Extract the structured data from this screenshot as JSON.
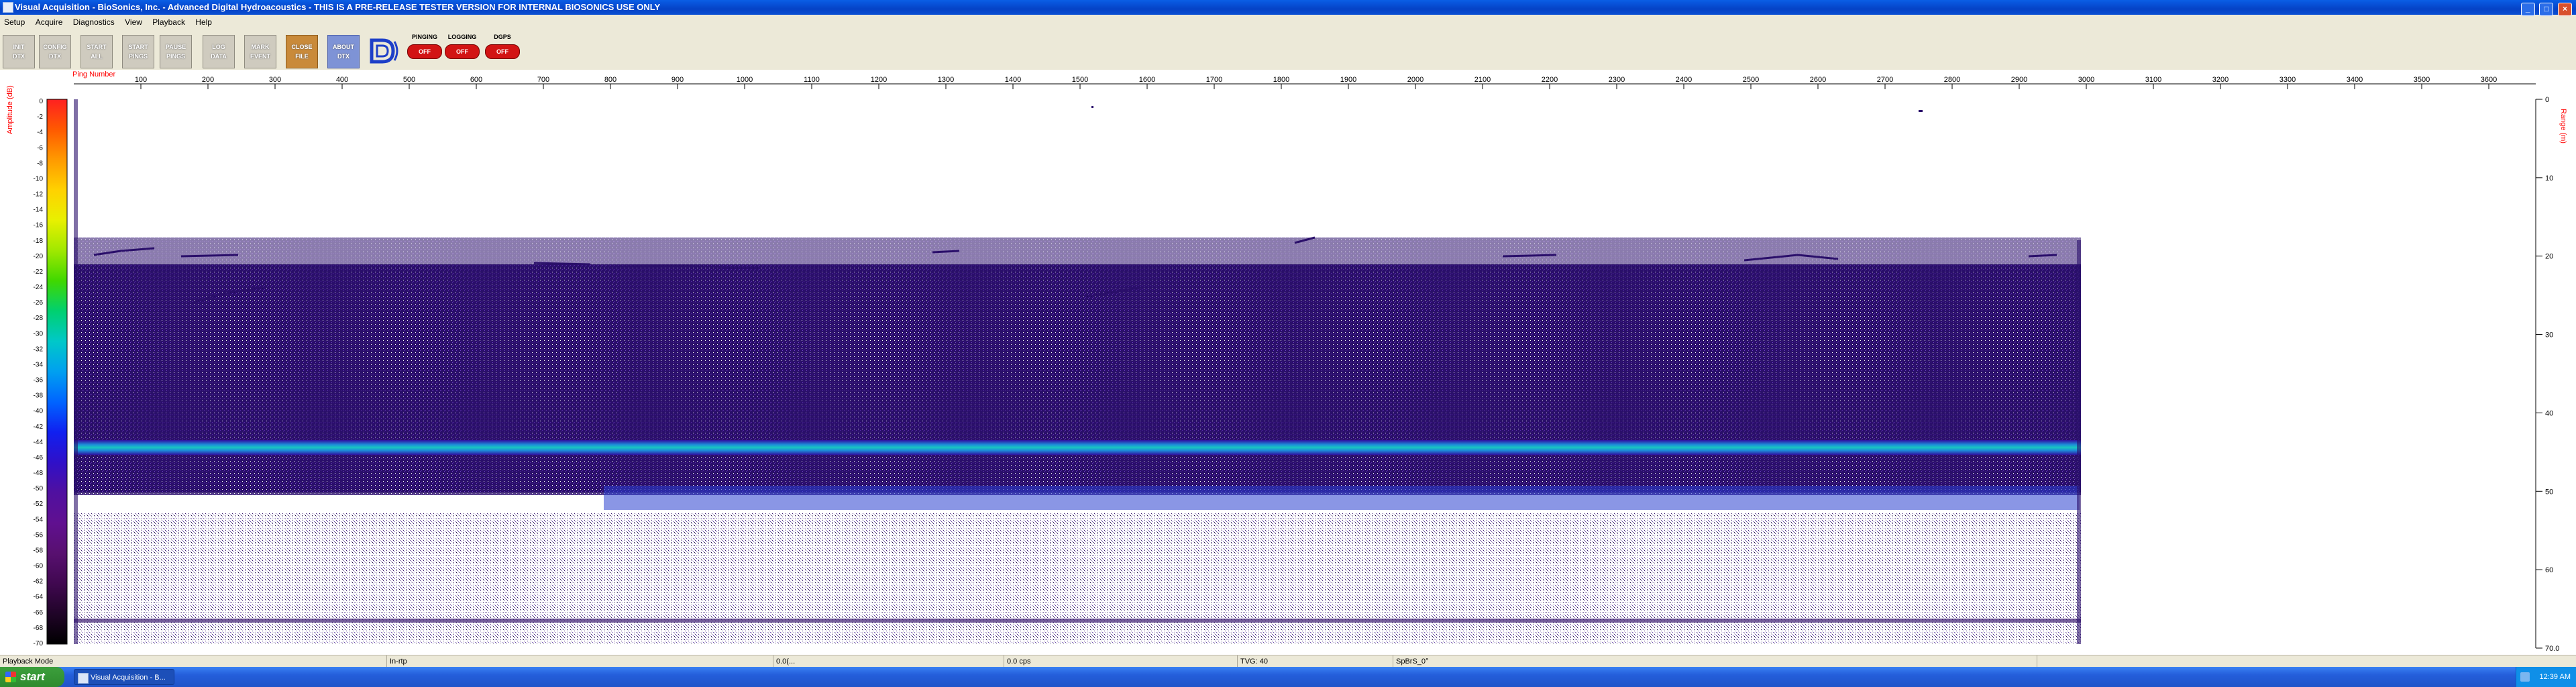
{
  "window": {
    "title": "Visual Acquisition  -  BioSonics, Inc.  -  Advanced Digital Hydroacoustics  -  THIS IS A PRE-RELEASE TESTER VERSION FOR INTERNAL BIOSONICS USE ONLY",
    "minimize": "_",
    "maximize": "□",
    "close": "×"
  },
  "menu": [
    "Setup",
    "Acquire",
    "Diagnostics",
    "View",
    "Playback",
    "Help"
  ],
  "toolbar": {
    "buttons": [
      {
        "label1": "INIT",
        "label2": "DTX",
        "style": "gray"
      },
      {
        "label1": "CONFIG",
        "label2": "DTX",
        "style": "gray"
      },
      {
        "label1": "START",
        "label2": "ALL",
        "style": "gray"
      },
      {
        "label1": "START",
        "label2": "PINGS",
        "style": "gray"
      },
      {
        "label1": "PAUSE",
        "label2": "PINGS",
        "style": "gray"
      },
      {
        "label1": "LOG",
        "label2": "DATA",
        "style": "gray"
      },
      {
        "label1": "MARK",
        "label2": "EVENT",
        "style": "gray"
      },
      {
        "label1": "CLOSE",
        "label2": "FILE",
        "style": "orange"
      },
      {
        "label1": "ABOUT",
        "label2": "DTX",
        "style": "blue"
      }
    ],
    "status_lights": [
      {
        "label": "PINGING",
        "state": "OFF"
      },
      {
        "label": "LOGGING",
        "state": "OFF"
      },
      {
        "label": "DGPS",
        "state": "OFF"
      }
    ]
  },
  "echogram": {
    "x_axis_label": "Ping Number",
    "x_ticks": [
      "100",
      "200",
      "300",
      "400",
      "500",
      "600",
      "700",
      "800",
      "900",
      "1000",
      "1100",
      "1200",
      "1300",
      "1400",
      "1500",
      "1600",
      "1700",
      "1800",
      "1900",
      "2000",
      "2100",
      "2200",
      "2300",
      "2400",
      "2500",
      "2600",
      "2700",
      "2800",
      "2900",
      "3000",
      "3100",
      "3200",
      "3300",
      "3400",
      "3500",
      "3600"
    ],
    "colorbar_label": "Amplitude (dB)",
    "colorbar_ticks": [
      "0",
      "-2",
      "-4",
      "-6",
      "-8",
      "-10",
      "-12",
      "-14",
      "-16",
      "-18",
      "-20",
      "-22",
      "-24",
      "-26",
      "-28",
      "-30",
      "-32",
      "-34",
      "-36",
      "-38",
      "-40",
      "-42",
      "-44",
      "-46",
      "-48",
      "-50",
      "-52",
      "-54",
      "-56",
      "-58",
      "-60",
      "-62",
      "-64",
      "-66",
      "-68",
      "-70"
    ],
    "colorbar_colors": [
      "#ff2020",
      "#ff5a00",
      "#ff9a00",
      "#ffd200",
      "#e8f000",
      "#a0e800",
      "#40d800",
      "#00d070",
      "#00c8c8",
      "#00a0f0",
      "#0064ff",
      "#1020f0",
      "#3010c8",
      "#5010a0",
      "#601090",
      "#581070",
      "#400850",
      "#200428",
      "#000000"
    ],
    "right_axis_label": "Range (m)",
    "depth_ticks": [
      "0",
      "10",
      "20",
      "30",
      "40",
      "50",
      "60",
      "70.0"
    ],
    "colors": {
      "bottom_echo": "#18c8c0",
      "scatter_layer": "#3a1d8c",
      "deep_band": "#2a3fd0",
      "accent_red": "#ff0000"
    }
  },
  "status": {
    "mode": "Playback Mode",
    "f2": "In-rtp",
    "f3": "0.0(...",
    "f4": "0.0 cps",
    "tvg": "TVG: 40",
    "sp": "SpBrS_0°"
  },
  "taskbar": {
    "start": "start",
    "items": [
      "Visual Acquisition",
      "B..."
    ],
    "clock": "12:39 AM"
  }
}
